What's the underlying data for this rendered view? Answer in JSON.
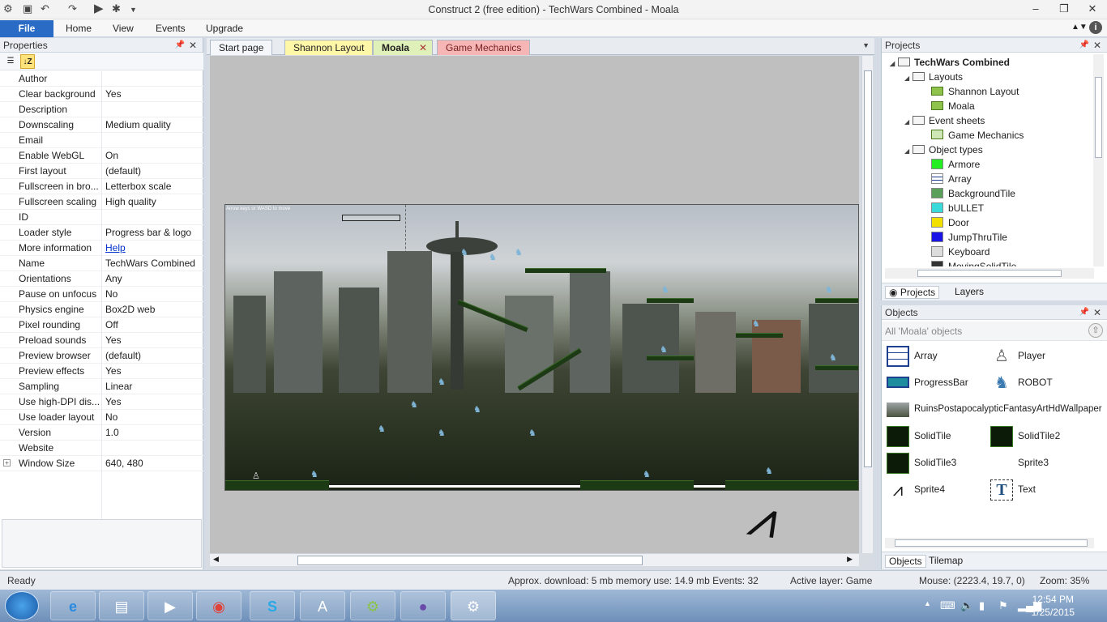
{
  "window": {
    "title": "Construct 2  (free edition) - TechWars Combined - Moala"
  },
  "ribbon": {
    "file": "File",
    "tabs": [
      "Home",
      "View",
      "Events",
      "Upgrade"
    ]
  },
  "properties": {
    "header": "Properties",
    "rows": [
      {
        "key": "Author",
        "value": ""
      },
      {
        "key": "Clear background",
        "value": "Yes"
      },
      {
        "key": "Description",
        "value": ""
      },
      {
        "key": "Downscaling",
        "value": "Medium quality"
      },
      {
        "key": "Email",
        "value": ""
      },
      {
        "key": "Enable WebGL",
        "value": "On"
      },
      {
        "key": "First layout",
        "value": "(default)"
      },
      {
        "key": "Fullscreen in bro...",
        "value": "Letterbox scale"
      },
      {
        "key": "Fullscreen scaling",
        "value": "High quality"
      },
      {
        "key": "ID",
        "value": ""
      },
      {
        "key": "Loader style",
        "value": "Progress bar & logo"
      },
      {
        "key": "More information",
        "value": "Help"
      },
      {
        "key": "Name",
        "value": "TechWars Combined"
      },
      {
        "key": "Orientations",
        "value": "Any"
      },
      {
        "key": "Pause on unfocus",
        "value": "No"
      },
      {
        "key": "Physics engine",
        "value": "Box2D web"
      },
      {
        "key": "Pixel rounding",
        "value": "Off"
      },
      {
        "key": "Preload sounds",
        "value": "Yes"
      },
      {
        "key": "Preview browser",
        "value": "(default)"
      },
      {
        "key": "Preview effects",
        "value": "Yes"
      },
      {
        "key": "Sampling",
        "value": "Linear"
      },
      {
        "key": "Use high-DPI dis...",
        "value": "Yes"
      },
      {
        "key": "Use loader layout",
        "value": "No"
      },
      {
        "key": "Version",
        "value": "1.0"
      },
      {
        "key": "Website",
        "value": ""
      },
      {
        "key": "Window Size",
        "value": "640, 480"
      }
    ]
  },
  "editor": {
    "tabs": [
      {
        "label": "Start page",
        "color": "#f4f6f9"
      },
      {
        "label": "Shannon Layout",
        "color": "#fff7a8"
      },
      {
        "label": "Moala",
        "color": "#dff0b8"
      },
      {
        "label": "Game Mechanics",
        "color": "#f6b6b6"
      }
    ],
    "hint_text": "Arrow keys or WASD to move"
  },
  "projects": {
    "header": "Projects",
    "root": "TechWars Combined",
    "layouts_folder": "Layouts",
    "layouts": [
      "Shannon Layout",
      "Moala"
    ],
    "event_folder": "Event sheets",
    "event_sheets": [
      "Game Mechanics"
    ],
    "objects_folder": "Object types",
    "object_types": [
      {
        "name": "Armore",
        "color": "#22ee22"
      },
      {
        "name": "Array",
        "color": "#ffffff"
      },
      {
        "name": "BackgroundTile",
        "color": "#5aa05a"
      },
      {
        "name": "bULLET",
        "color": "#3adada"
      },
      {
        "name": "Door",
        "color": "#f2e000"
      },
      {
        "name": "JumpThruTile",
        "color": "#1a14e6"
      },
      {
        "name": "Keyboard",
        "color": "#dddddd"
      },
      {
        "name": "MovingSolidTile",
        "color": "#333333"
      }
    ],
    "tabs": [
      "Projects",
      "Layers"
    ]
  },
  "objects": {
    "header": "Objects",
    "filter": "All 'Moala' objects",
    "items": [
      {
        "name": "Array"
      },
      {
        "name": "Player"
      },
      {
        "name": "ProgressBar"
      },
      {
        "name": "ROBOT"
      },
      {
        "name": "RuinsPostapocalypticFantasyArtHdWallpaper"
      },
      {
        "name": "SolidTile"
      },
      {
        "name": "SolidTile2"
      },
      {
        "name": "SolidTile3"
      },
      {
        "name": "Sprite3"
      },
      {
        "name": "Sprite4"
      },
      {
        "name": "Text"
      }
    ],
    "tabs": [
      "Objects",
      "Tilemap"
    ]
  },
  "status": {
    "ready": "Ready",
    "download": "Approx. download: 5 mb  memory use: 14.9 mb  Events: 32",
    "layer": "Active layer: Game",
    "mouse": "Mouse: (2223.4, 19.7, 0)",
    "zoom": "Zoom: 35%"
  },
  "taskbar": {
    "time": "12:54 PM",
    "date": "1/25/2015"
  }
}
